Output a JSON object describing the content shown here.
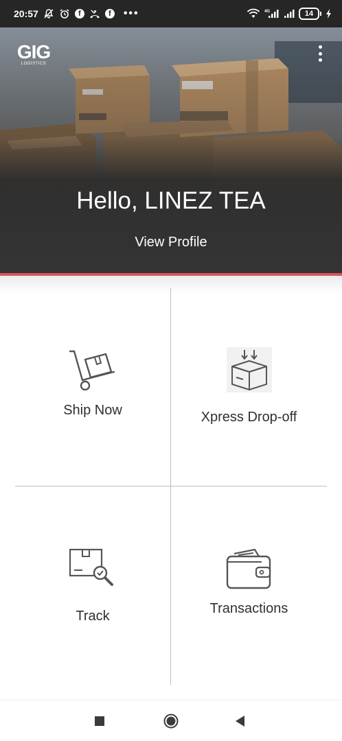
{
  "status_bar": {
    "time": "20:57",
    "battery_level": "14",
    "more_indicator": "•••",
    "icons": [
      "notifications-off-icon",
      "alarm-icon",
      "facebook-icon",
      "missed-call-icon",
      "facebook-icon",
      "wifi-icon",
      "signal-4g-icon",
      "signal-icon",
      "battery-icon",
      "charging-icon"
    ]
  },
  "header": {
    "logo_text": "GIG",
    "logo_subtext": "LOGISTICS",
    "greeting": "Hello, LINEZ TEA",
    "profile_link": "View Profile",
    "menu_icon": "more-vertical-icon",
    "accent_color": "#d9555a"
  },
  "tiles": [
    {
      "label": "Ship Now",
      "icon": "hand-truck-icon"
    },
    {
      "label": "Xpress Drop-off",
      "icon": "box-drop-icon"
    },
    {
      "label": "Track",
      "icon": "package-search-icon"
    },
    {
      "label": "Transactions",
      "icon": "wallet-icon"
    }
  ],
  "nav_bar": {
    "icons": [
      "recents-square-icon",
      "home-circle-icon",
      "back-triangle-icon"
    ]
  }
}
